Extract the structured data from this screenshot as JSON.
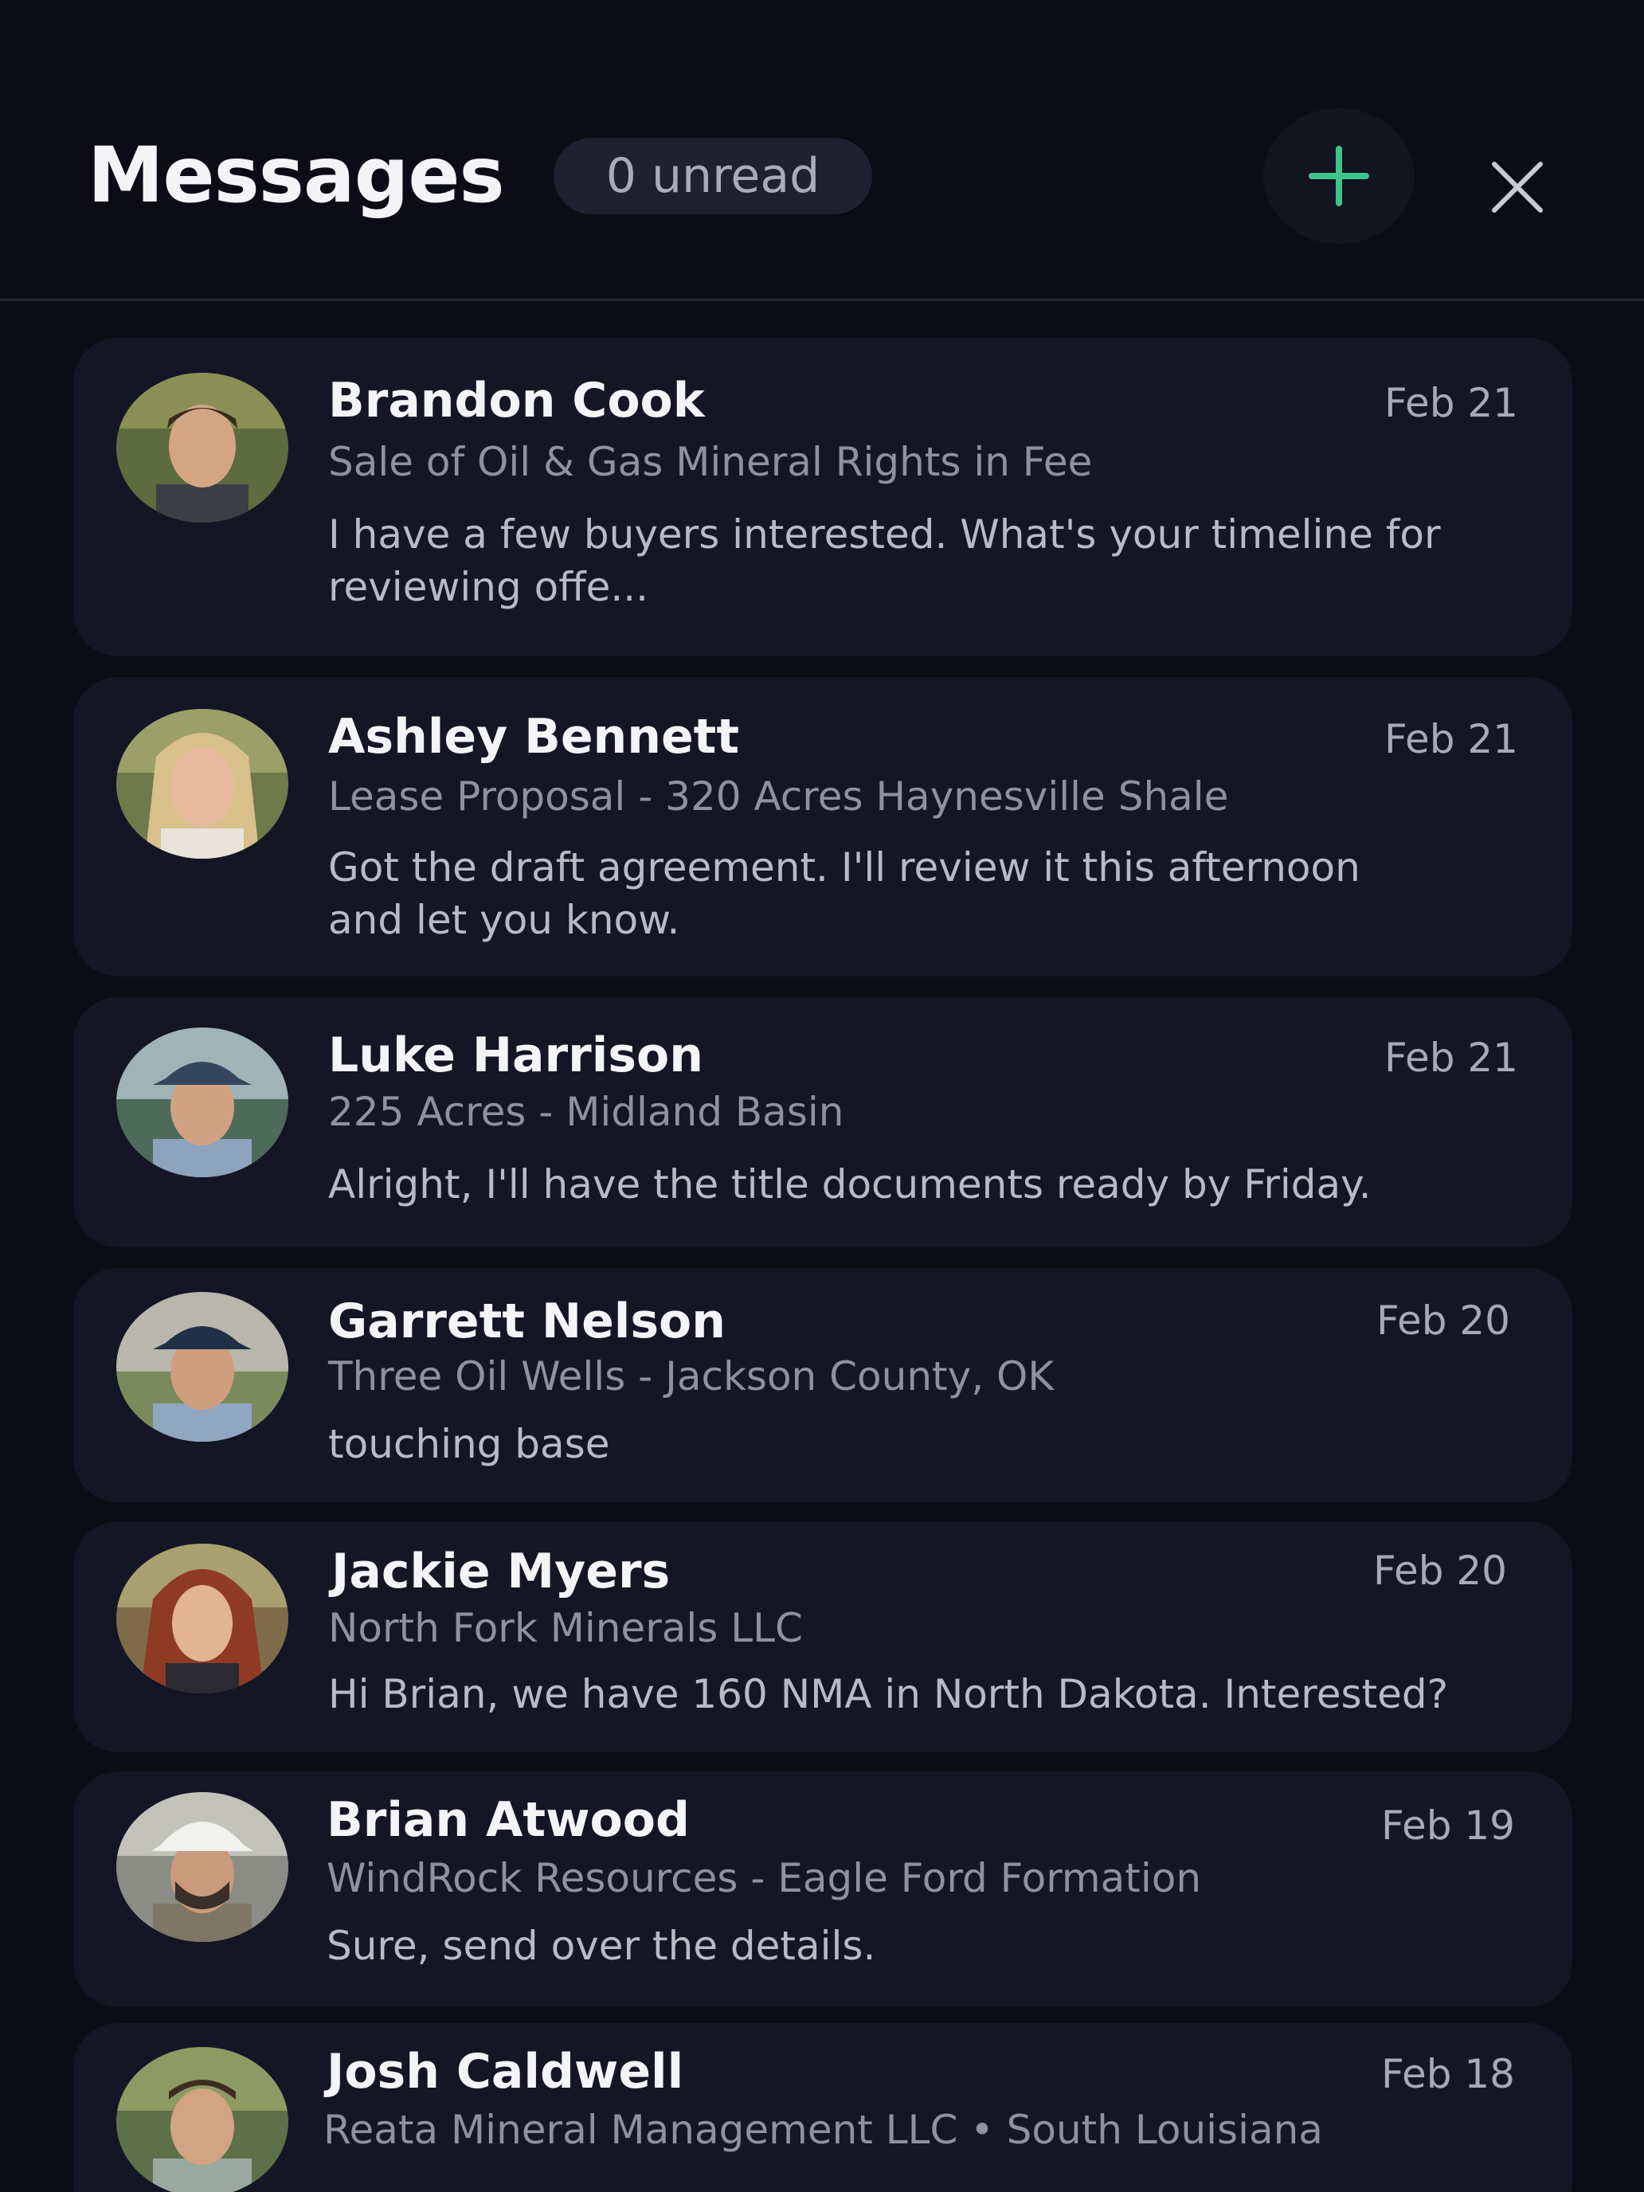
{
  "header": {
    "title": "Messages",
    "unread_label": "0 unread"
  },
  "colors": {
    "background": "#0b0c16",
    "card": "#141626",
    "accent_green": "#3ec48a",
    "text_primary": "#f4f4f7",
    "text_secondary": "#8f91a1"
  },
  "icons": {
    "add": "plus-icon",
    "close": "close-icon"
  },
  "conversations": [
    {
      "name": "Brandon Cook",
      "date": "Feb 21",
      "subject": "Sale of Oil & Gas  Mineral Rights in Fee",
      "preview": "I have a few buyers interested. What's your timeline for reviewing offe..."
    },
    {
      "name": "Ashley Bennett",
      "date": "Feb 21",
      "subject": "Lease Proposal - 320 Acres Haynesville Shale",
      "preview": "Got the draft agreement. I'll review it this afternoon and let you know."
    },
    {
      "name": "Luke Harrison",
      "date": "Feb 21",
      "subject": "225 Acres  - Midland Basin",
      "preview": "Alright, I'll have the title documents ready by Friday."
    },
    {
      "name": "Garrett Nelson",
      "date": "Feb 20",
      "subject": "Three Oil Wells - Jackson County, OK",
      "preview": "touching base"
    },
    {
      "name": "Jackie Myers",
      "date": "Feb 20",
      "subject": "North Fork Minerals LLC",
      "preview": "Hi Brian, we have 160 NMA in North Dakota. Interested?"
    },
    {
      "name": "Brian Atwood",
      "date": "Feb 19",
      "subject": "WindRock Resources  - Eagle Ford Formation",
      "preview": "Sure, send over the details."
    },
    {
      "name": "Josh Caldwell",
      "date": "Feb 18",
      "subject": "Reata Mineral Management LLC  •  South Louisiana",
      "preview": ""
    }
  ]
}
